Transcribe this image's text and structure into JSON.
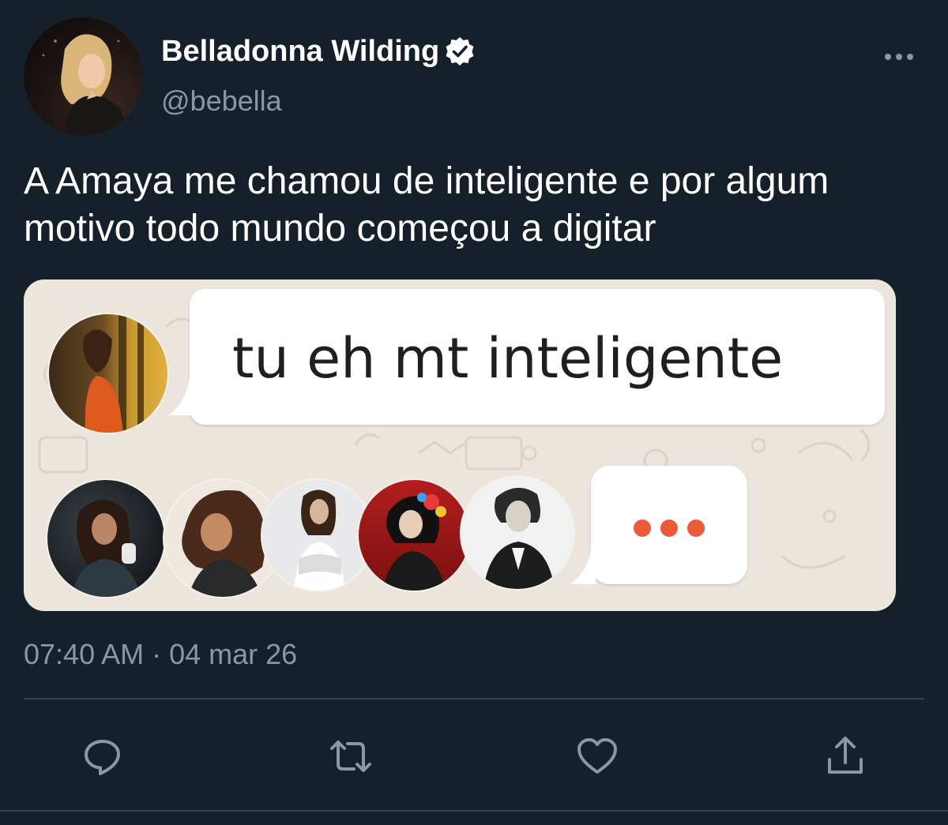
{
  "tweet": {
    "author": {
      "display_name": "Belladonna Wilding",
      "handle": "@bebella",
      "verified": true,
      "avatar": "profile-photo"
    },
    "text": "A Amaya me chamou de inteligente e por algum motivo todo mundo começou a digitar",
    "media": {
      "message_text": "tu eh mt inteligente",
      "typing_indicator": "•••",
      "typing_dot_color": "#ec5a3a",
      "chat_background": "#ece5dd"
    },
    "time": "07:40 AM",
    "separator": "·",
    "date": "04 mar 26"
  },
  "icons": {
    "more": "more-horizontal-icon",
    "reply": "reply-icon",
    "retweet": "retweet-icon",
    "like": "heart-icon",
    "share": "share-icon"
  },
  "colors": {
    "background": "#15202b",
    "secondary_text": "#8899a6",
    "divider": "#38444d"
  }
}
